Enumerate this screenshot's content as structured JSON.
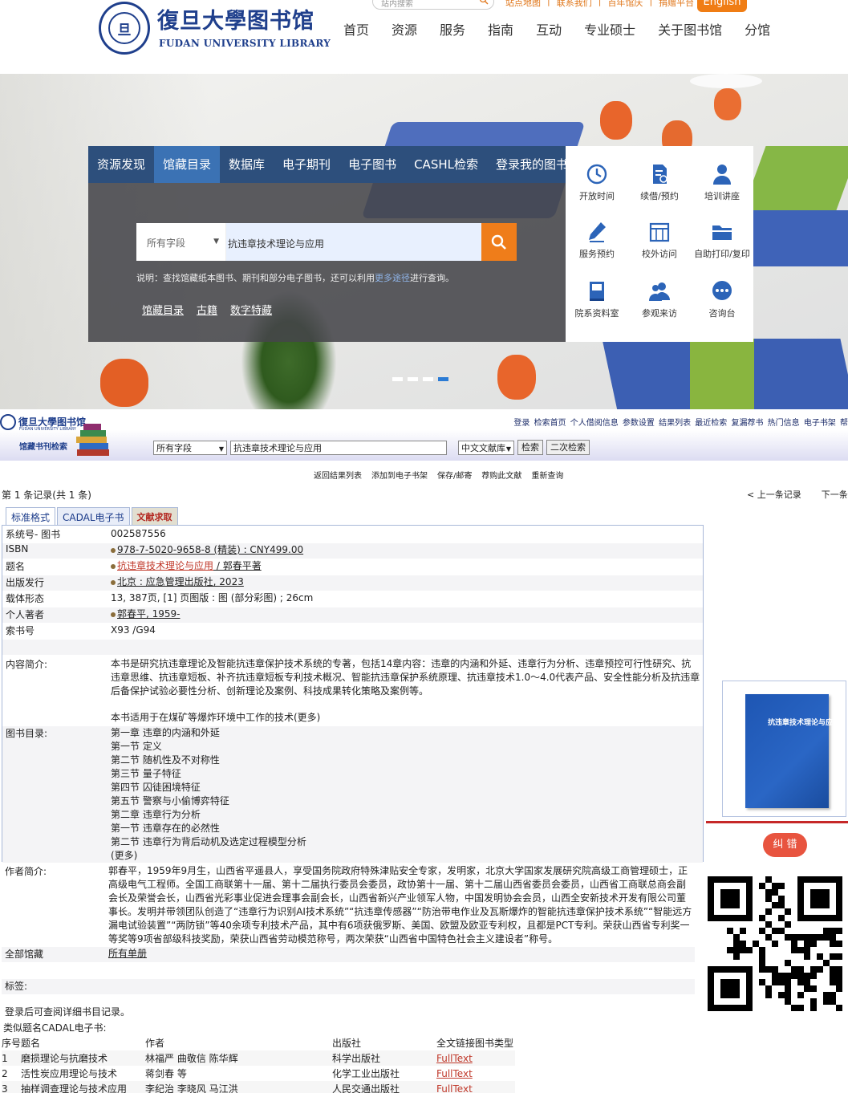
{
  "header": {
    "logo_cn": "復旦大學图书馆",
    "logo_en": "FUDAN UNIVERSITY LIBRARY",
    "seal_text": "旦",
    "site_search_placeholder": "站内搜索",
    "top_links": [
      "站点地图",
      "联系我们",
      "百年馆庆",
      "捐赠平台"
    ],
    "english_label": "English",
    "nav": [
      "首页",
      "资源",
      "服务",
      "指南",
      "互动",
      "专业硕士",
      "关于图书馆",
      "分馆"
    ]
  },
  "hero": {
    "search_tabs": [
      "资源发现",
      "馆藏目录",
      "数据库",
      "电子期刊",
      "电子图书",
      "CASHL检索",
      "登录我的图书馆"
    ],
    "active_tab": "馆藏目录",
    "field_select": "所有字段",
    "query": "抗违章技术理论与应用",
    "note_prefix": "说明：查找馆藏纸本图书、期刊和部分电子图书，还可以利用",
    "note_link": "更多途径",
    "note_suffix": "进行查询。",
    "sub_links": [
      "馆藏目录",
      "古籍",
      "数字特藏"
    ],
    "quick_links": [
      {
        "label": "开放时间",
        "icon": "clock-icon"
      },
      {
        "label": "续借/预约",
        "icon": "renew-icon"
      },
      {
        "label": "培训讲座",
        "icon": "person-icon"
      },
      {
        "label": "服务预约",
        "icon": "pen-icon"
      },
      {
        "label": "校外访问",
        "icon": "calendar-icon"
      },
      {
        "label": "自助打印/复印",
        "icon": "folder-icon"
      },
      {
        "label": "院系资料室",
        "icon": "book-icon"
      },
      {
        "label": "参观来访",
        "icon": "group-icon"
      },
      {
        "label": "咨询台",
        "icon": "chat-icon"
      }
    ],
    "carousel_active_index": 3
  },
  "opac": {
    "logo_cn": "復旦大學图书馆",
    "logo_en": "FUDAN UNIVERSITY LIBRARY",
    "subtitle": "馆藏书刊检索",
    "top_links": "登录 检索首页 个人借阅信息 参数设置 结果列表 最近检索 复漏荐书 热门信息 电子书架 帮",
    "field_select": "所有字段",
    "query": "抗违章技术理论与应用",
    "db_select": "中文文献库",
    "search_button": "检索",
    "secondary_button": "二次检索",
    "actions": [
      "返回结果列表",
      "添加到电子书架",
      "保存/邮寄",
      "荐购此文献",
      "重新查询"
    ],
    "record_count": "第 1 条记录(共 1 条)",
    "prev": "< 上一条记录",
    "next": "下一条记",
    "tabs": [
      "标准格式",
      "CADAL电子书",
      "文献求取"
    ],
    "fields": {
      "sysno_label": "系统号- 图书",
      "sysno": "002587556",
      "isbn_label": "ISBN",
      "isbn": "978-7-5020-9658-8 (精装) : CNY499.00",
      "title_label": "题名",
      "title": "抗违章技术理论与应用",
      "title_resp": " / 郭春平著",
      "pub_label": "出版发行",
      "pub": "北京 : 应急管理出版社, 2023",
      "phys_label": "载体形态",
      "phys": "13, 387页, [1] 页图版 : 图 (部分彩图) ; 26cm",
      "author_label": "个人著者",
      "author": "郭春平, 1959-",
      "call_label": "索书号",
      "call": "X93 /G94",
      "summary_label": "内容简介:",
      "summary": "本书是研究抗违章理论及智能抗违章保护技术系统的专著，包括14章内容：违章的内涵和外延、违章行为分析、违章预控可行性研究、抗违章思维、抗违章短板、补齐抗违章短板专利技术概况、智能抗违章保护系统原理、抗违章技术1.0～4.0代表产品、安全性能分析及抗违章后备保护试验必要性分析、创新理论及案例、科技成果转化策略及案例等。",
      "summary2": "本书适用于在煤矿等爆炸环境中工作的技术(更多)",
      "toc_label": "图书目录:",
      "toc": [
        "第一章 违章的内涵和外延",
        "第一节 定义",
        "第二节 随机性及不对称性",
        "第三节 量子特征",
        "第四节 囚徒困境特征",
        "第五节 警察与小偷博弈特征",
        "第二章 违章行为分析",
        "第一节 违章存在的必然性",
        "第二节 违章行为背后动机及选定过程模型分析",
        "(更多)"
      ],
      "bio_label": "作者简介:",
      "bio": "郭春平，1959年9月生，山西省平遥县人，享受国务院政府特殊津贴安全专家，发明家，北京大学国家发展研究院高级工商管理硕士，正高级电气工程师。全国工商联第十一届、第十二届执行委员会委员，政协第十一届、第十二届山西省委员会委员，山西省工商联总商会副会长及荣誉会长，山西省光彩事业促进会理事会副会长，山西省新兴产业领军人物，中国发明协会会员，山西全安新技术开发有限公司董事长。发明并带领团队创造了“违章行为识别AI技术系统”“抗违章传感器”“防治带电作业及瓦斯爆炸的智能抗违章保护技术系统”“智能远方漏电试验装置”“两防锁”等40余项专利技术产品，其中有6项获俄罗斯、美国、欧盟及欧亚专利权，且都是PCT专利。荣获山西省专利奖一等奖等9项省部级科技奖励，荣获山西省劳动模范称号，两次荣获“山西省中国特色社会主义建设者”称号。",
      "holdings_label": "全部馆藏",
      "holdings": "所有单册",
      "tags_label": "标签:"
    },
    "login_note": "登录后可查阅详细书目记录。",
    "similar_title": "类似题名CADAL电子书:",
    "similar_headers": [
      "序号",
      "题名",
      "作者",
      "出版社",
      "全文链接",
      "图书类型"
    ],
    "similar_rows": [
      {
        "no": "1",
        "title": "磨损理论与抗磨技术",
        "author": "林福严 曲敬信 陈华辉",
        "publisher": "科学出版社",
        "link": "FullText"
      },
      {
        "no": "2",
        "title": "活性炭应用理论与技术",
        "author": "蒋剑春 等",
        "publisher": "化学工业出版社",
        "link": "FullText"
      },
      {
        "no": "3",
        "title": "抽样调查理论与技术应用",
        "author": "李纪治 李晓风 马江洪",
        "publisher": "人民交通出版社",
        "link": "FullText"
      }
    ],
    "cover_title": "抗违章技术理论与应用",
    "correct_button": "纠 错"
  }
}
